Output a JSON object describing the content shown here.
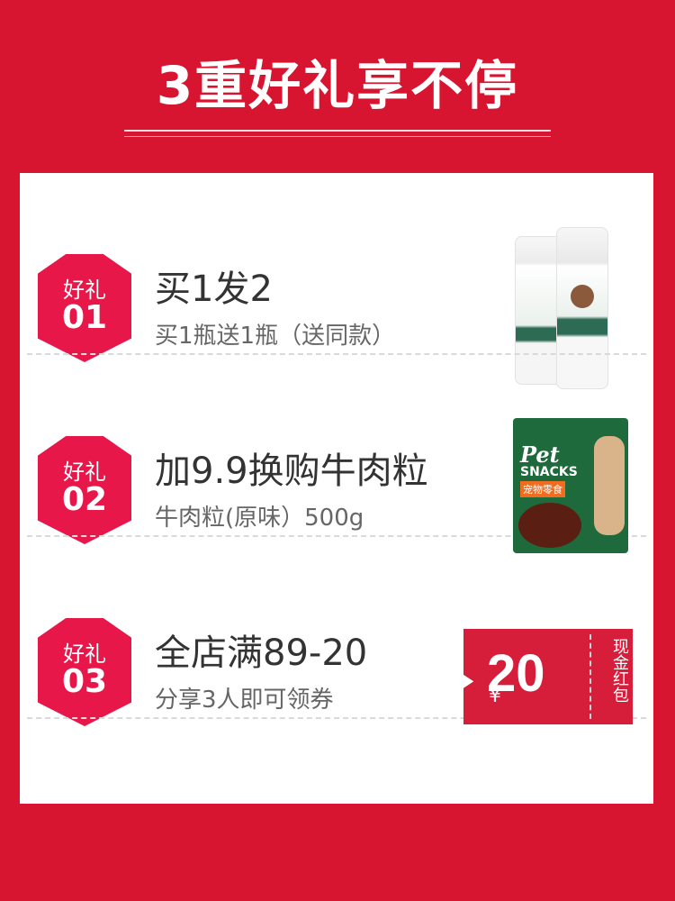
{
  "header": {
    "title": "3重好礼享不停"
  },
  "rows": [
    {
      "badge_label": "好礼",
      "badge_number": "01",
      "title": "买1发2",
      "subtitle": "买1瓶送1瓶（送同款）",
      "product_icon": "spray-bottles-icon"
    },
    {
      "badge_label": "好礼",
      "badge_number": "02",
      "title": "加9.9换购牛肉粒",
      "subtitle": "牛肉粒(原味）500g",
      "product_icon": "pet-snacks-bag-icon",
      "bag_text_1": "Pet",
      "bag_text_2": "SNACKS",
      "bag_tag": "宠物零食"
    },
    {
      "badge_label": "好礼",
      "badge_number": "03",
      "title": "全店满89-20",
      "subtitle": "分享3人即可领券",
      "coupon_currency": "¥",
      "coupon_amount": "20",
      "coupon_side_text": "现金红包"
    }
  ],
  "colors": {
    "page_background": "#d81530",
    "badge": "#e8174a",
    "coupon": "#d61d3a"
  }
}
